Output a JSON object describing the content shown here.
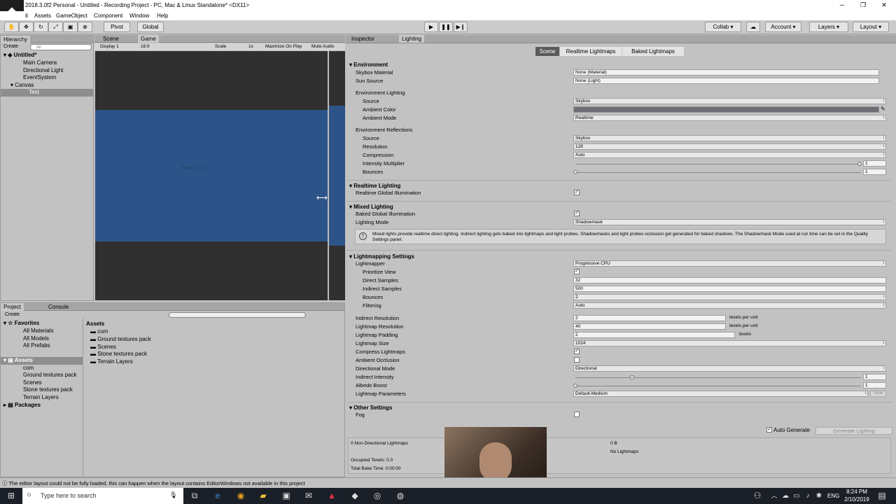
{
  "window": {
    "title": "2018.3.0f2 Personal - Untitled - Recording Project - PC, Mac & Linux Standalone* <DX11>",
    "logo": "unity-logo-icon"
  },
  "menu": [
    "it",
    "Assets",
    "GameObject",
    "Component",
    "Window",
    "Help"
  ],
  "toolbar": {
    "pivot": "Pivot",
    "global": "Global",
    "collab": "Collab",
    "account": "Account",
    "layers": "Layers",
    "layout": "Layout"
  },
  "hierarchy": {
    "tab": "Hierarchy",
    "create": "Create",
    "search_placeholder": "All",
    "scene": "Untitled*",
    "items": [
      "Main Camera",
      "Directional Light",
      "EventSystem",
      "Canvas",
      "Text"
    ]
  },
  "game": {
    "tab_scene": "Scene",
    "tab_game": "Game",
    "display": "Display 1",
    "aspect": "16:9",
    "scale_label": "Scale",
    "scale_value": "1x",
    "maximize": "Maximize On Play",
    "mute": "Mute Audio",
    "canvas_text": "New Text"
  },
  "project": {
    "tab_project": "Project",
    "tab_console": "Console",
    "create": "Create",
    "favorites": "Favorites",
    "fav_items": [
      "All Materials",
      "All Models",
      "All Prefabs"
    ],
    "assets": "Assets",
    "asset_tree": [
      "com",
      "Ground textures pack",
      "Scenes",
      "Stone textures pack",
      "Terrain Layers"
    ],
    "packages": "Packages",
    "breadcrumb": "Assets",
    "folders": [
      "com",
      "Ground textures pack",
      "Scenes",
      "Stone textures pack",
      "Terrain Layers"
    ]
  },
  "inspector": {
    "tab_inspector": "Inspector",
    "tab_lighting": "Lighting",
    "modes": [
      "Scene",
      "Realtime Lightmaps",
      "Baked Lightmaps"
    ]
  },
  "lighting": {
    "environment": "Environment",
    "skybox_material_label": "Skybox Material",
    "skybox_material": "None (Material)",
    "sun_source_label": "Sun Source",
    "sun_source": "None (Light)",
    "env_lighting": "Environment Lighting",
    "source_label": "Source",
    "source": "Skybox",
    "ambient_color_label": "Ambient Color",
    "ambient_mode_label": "Ambient Mode",
    "ambient_mode": "Realtime",
    "env_reflections": "Environment Reflections",
    "refl_source": "Skybox",
    "resolution_label": "Resolution",
    "resolution": "128",
    "compression_label": "Compression",
    "compression": "Auto",
    "intensity_label": "Intensity Multiplier",
    "intensity": "1",
    "bounces_label": "Bounces",
    "bounces": "1",
    "realtime": "Realtime Lighting",
    "rgi_label": "Realtime Global Illumination",
    "mixed": "Mixed Lighting",
    "bgi_label": "Baked Global Illumination",
    "lighting_mode_label": "Lighting Mode",
    "lighting_mode": "Shadowmask",
    "info": "Mixed lights provide realtime direct lighting. Indirect lighting gets baked into lightmaps and light probes. Shadowmasks and light probes occlusion get generated for baked shadows. The Shadowmask Mode used at run time can be set in the Quality Settings panel.",
    "lightmapping": "Lightmapping Settings",
    "lightmapper_label": "Lightmapper",
    "lightmapper": "Progressive CPU",
    "prioritize_label": "Prioritize View",
    "direct_label": "Direct Samples",
    "direct": "32",
    "indirect_label": "Indirect Samples",
    "indirect": "500",
    "lm_bounces": "2",
    "filtering_label": "Filtering",
    "filtering": "Auto",
    "indirect_res_label": "Indirect Resolution",
    "indirect_res": "2",
    "lm_res_label": "Lightmap Resolution",
    "lm_res": "40",
    "texels_per_unit": "texels per unit",
    "padding_label": "Lightmap Padding",
    "padding": "2",
    "texels": "texels",
    "size_label": "Lightmap Size",
    "size": "1024",
    "compress_label": "Compress Lightmaps",
    "ao_label": "Ambient Occlusion",
    "dir_mode_label": "Directional Mode",
    "dir_mode": "Directional",
    "ind_intensity_label": "Indirect Intensity",
    "ind_intensity": "1",
    "albedo_label": "Albedo Boost",
    "albedo": "1",
    "params_label": "Lightmap Parameters",
    "params": "Default-Medium",
    "view": "View",
    "other": "Other Settings",
    "fog_label": "Fog",
    "auto_generate": "Auto Generate",
    "generate": "Generate Lighting",
    "stats_lightmaps": "0 Non-Directional Lightmaps",
    "stats_bytes": "0 B",
    "stats_none": "No Lightmaps",
    "occupied": "Occupied Texels: 0.0",
    "bake_time": "Total Bake Time: 0:00:00"
  },
  "status": "The editor layout could not be fully loaded, this can happen when the layout contains EditorWindows not available in this project",
  "taskbar": {
    "search": "Type here to search",
    "lang": "ENG",
    "time": "8:24 PM",
    "date": "2/10/2019"
  },
  "colors": {
    "game_blue": "#2d5488",
    "dark": "#303030"
  }
}
